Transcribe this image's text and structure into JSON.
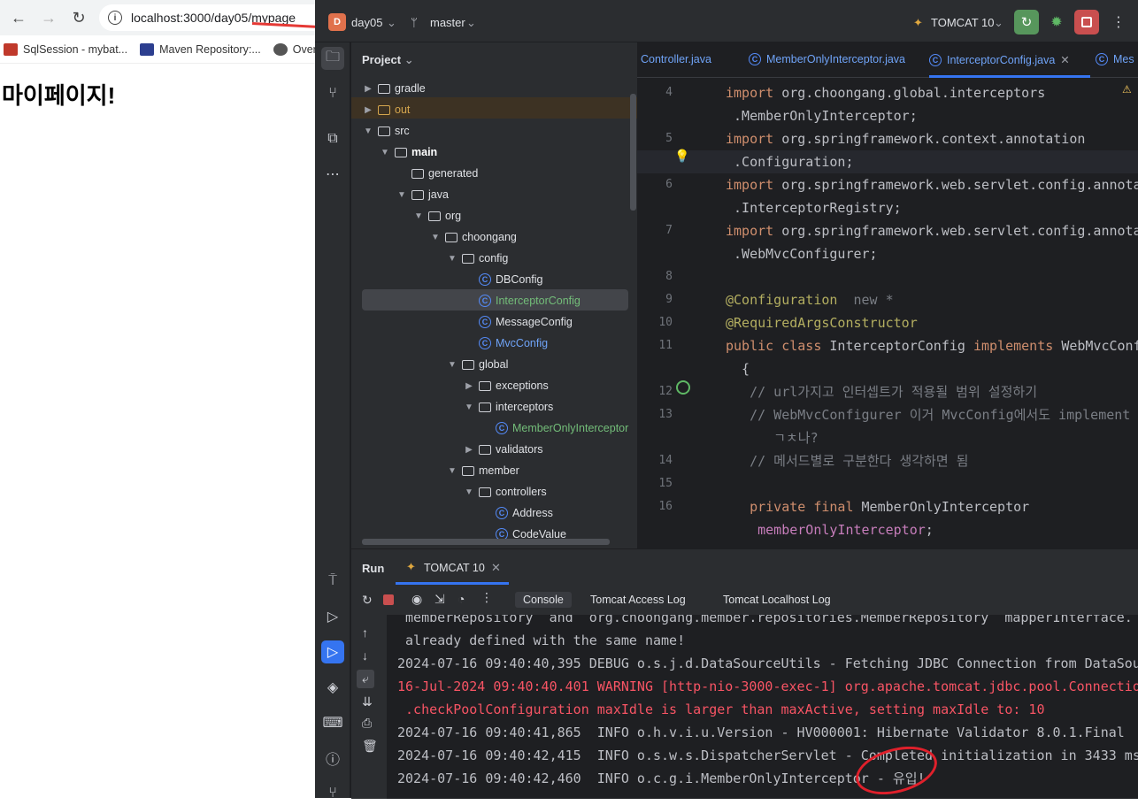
{
  "browser": {
    "url": "localhost:3000/day05/mypage",
    "bookmarks": [
      {
        "label": "SqlSession - mybat...",
        "icon": "mybatis-icon"
      },
      {
        "label": "Maven Repository:...",
        "icon": "maven-icon"
      },
      {
        "label": "Overv",
        "icon": "globe-icon"
      }
    ],
    "page_heading": "마이페이지!"
  },
  "ide": {
    "project_name": "day05",
    "project_letter": "D",
    "branch": "master",
    "run_config": "TOMCAT 10",
    "project_panel_title": "Project",
    "tree": [
      {
        "label": "gradle",
        "kind": "folder",
        "depth": 0,
        "arrow": "▶",
        "color": "#dfe1e5"
      },
      {
        "label": "out",
        "kind": "folder",
        "depth": 0,
        "arrow": "▶",
        "color": "#d5a64e"
      },
      {
        "label": "src",
        "kind": "folder",
        "depth": 0,
        "arrow": "▼",
        "color": "#dfe1e5"
      },
      {
        "label": "main",
        "kind": "folder",
        "depth": 1,
        "arrow": "▼",
        "color": "#ffffff",
        "bold": true
      },
      {
        "label": "generated",
        "kind": "folder",
        "depth": 2,
        "arrow": "",
        "color": "#dfe1e5"
      },
      {
        "label": "java",
        "kind": "folder",
        "depth": 2,
        "arrow": "▼",
        "color": "#dfe1e5"
      },
      {
        "label": "org",
        "kind": "folder",
        "depth": 3,
        "arrow": "▼",
        "color": "#dfe1e5"
      },
      {
        "label": "choongang",
        "kind": "folder",
        "depth": 4,
        "arrow": "▼",
        "color": "#dfe1e5"
      },
      {
        "label": "config",
        "kind": "folder",
        "depth": 5,
        "arrow": "▼",
        "color": "#dfe1e5"
      },
      {
        "label": "DBConfig",
        "kind": "class",
        "depth": 6,
        "arrow": "",
        "color": "#dfe1e5"
      },
      {
        "label": "InterceptorConfig",
        "kind": "class",
        "depth": 6,
        "arrow": "",
        "color": "#73bd79"
      },
      {
        "label": "MessageConfig",
        "kind": "class",
        "depth": 6,
        "arrow": "",
        "color": "#dfe1e5"
      },
      {
        "label": "MvcConfig",
        "kind": "class",
        "depth": 6,
        "arrow": "",
        "color": "#6fa3f7"
      },
      {
        "label": "global",
        "kind": "folder",
        "depth": 5,
        "arrow": "▼",
        "color": "#dfe1e5"
      },
      {
        "label": "exceptions",
        "kind": "folder",
        "depth": 6,
        "arrow": "▶",
        "color": "#dfe1e5"
      },
      {
        "label": "interceptors",
        "kind": "folder",
        "depth": 6,
        "arrow": "▼",
        "color": "#dfe1e5"
      },
      {
        "label": "MemberOnlyInterceptor",
        "kind": "class",
        "depth": 7,
        "arrow": "",
        "color": "#73bd79"
      },
      {
        "label": "validators",
        "kind": "folder",
        "depth": 6,
        "arrow": "▶",
        "color": "#dfe1e5"
      },
      {
        "label": "member",
        "kind": "folder",
        "depth": 5,
        "arrow": "▼",
        "color": "#dfe1e5"
      },
      {
        "label": "controllers",
        "kind": "folder",
        "depth": 6,
        "arrow": "▼",
        "color": "#dfe1e5"
      },
      {
        "label": "Address",
        "kind": "class",
        "depth": 7,
        "arrow": "",
        "color": "#dfe1e5"
      },
      {
        "label": "CodeValue",
        "kind": "class",
        "depth": 7,
        "arrow": "",
        "color": "#dfe1e5"
      }
    ],
    "tabs": [
      {
        "label": "Controller.java",
        "active": false
      },
      {
        "label": "MemberOnlyInterceptor.java",
        "active": false
      },
      {
        "label": "InterceptorConfig.java",
        "active": true
      },
      {
        "label": "Mes",
        "active": false
      }
    ],
    "line_numbers": [
      "4",
      "5",
      "6",
      "7",
      "8",
      "9",
      "10",
      "11",
      "12",
      "13",
      "14",
      "15",
      "16"
    ],
    "code_lines": [
      [
        {
          "t": "import ",
          "c": "kw"
        },
        {
          "t": "org.choongang.global.interceptors",
          "c": "pl"
        }
      ],
      [
        {
          "t": " .MemberOnlyInterceptor;",
          "c": "pl"
        }
      ],
      [
        {
          "t": "import ",
          "c": "kw"
        },
        {
          "t": "org.springframework.context.annotation",
          "c": "pl"
        }
      ],
      [
        {
          "t": " .Configuration;",
          "c": "pl"
        }
      ],
      [
        {
          "t": "import ",
          "c": "kw"
        },
        {
          "t": "org.springframework.web.servlet.config.annota",
          "c": "pl"
        }
      ],
      [
        {
          "t": " .InterceptorRegistry;",
          "c": "pl"
        }
      ],
      [
        {
          "t": "import ",
          "c": "kw"
        },
        {
          "t": "org.springframework.web.servlet.config.annota",
          "c": "pl"
        }
      ],
      [
        {
          "t": " .WebMvcConfigurer;",
          "c": "pl"
        }
      ],
      [
        {
          "t": "",
          "c": "pl"
        }
      ],
      [
        {
          "t": "@Configuration",
          "c": "an"
        },
        {
          "t": "  new *",
          "c": "cm"
        }
      ],
      [
        {
          "t": "@RequiredArgsConstructor",
          "c": "an"
        }
      ],
      [
        {
          "t": "public class ",
          "c": "kw"
        },
        {
          "t": "InterceptorConfig ",
          "c": "pl"
        },
        {
          "t": "implements ",
          "c": "kw"
        },
        {
          "t": "WebMvcConf",
          "c": "pl"
        }
      ],
      [
        {
          "t": "  {",
          "c": "pl"
        }
      ],
      [
        {
          "t": "   // url가지고 인터셉트가 적용될 범위 설정하기",
          "c": "cm"
        }
      ],
      [
        {
          "t": "   // WebMvcConfigurer 이거 MvcConfig에서도 implement",
          "c": "cm"
        }
      ],
      [
        {
          "t": "      ㄱㅊ나?",
          "c": "cm"
        }
      ],
      [
        {
          "t": "   // 메서드별로 구분한다 생각하면 됨",
          "c": "cm"
        }
      ],
      [
        {
          "t": "",
          "c": "pl"
        }
      ],
      [
        {
          "t": "   private final ",
          "c": "kw"
        },
        {
          "t": "MemberOnlyInterceptor",
          "c": "pl"
        }
      ],
      [
        {
          "t": "    memberOnlyInterceptor",
          "c": "fd"
        },
        {
          "t": ";",
          "c": "pl"
        }
      ]
    ],
    "run_panel": {
      "title": "Run",
      "tab": "TOMCAT 10",
      "subtabs": [
        "Console",
        "Tomcat Access Log",
        "Tomcat Localhost Log"
      ],
      "console_lines": [
        {
          "text": " memberRepository  and  org.choongang.member.repositories.MemberRepository  mapperInterface.",
          "type": "info"
        },
        {
          "text": " already defined with the same name!",
          "type": "info"
        },
        {
          "text": "2024-07-16 09:40:40,395 DEBUG o.s.j.d.DataSourceUtils - Fetching JDBC Connection from DataSou",
          "type": "info"
        },
        {
          "text": "16-Jul-2024 09:40:40.401 WARNING [http-nio-3000-exec-1] org.apache.tomcat.jdbc.pool.Connectio",
          "type": "warn"
        },
        {
          "text": " .checkPoolConfiguration maxIdle is larger than maxActive, setting maxIdle to: 10",
          "type": "warn"
        },
        {
          "text": "2024-07-16 09:40:41,865  INFO o.h.v.i.u.Version - HV000001: Hibernate Validator 8.0.1.Final",
          "type": "info"
        },
        {
          "text": "2024-07-16 09:40:42,415  INFO o.s.w.s.DispatcherServlet - Completed initialization in 3433 ms",
          "type": "info"
        },
        {
          "text": "2024-07-16 09:40:42,460  INFO o.c.g.i.MemberOnlyInterceptor - 유입!",
          "type": "info"
        }
      ]
    }
  }
}
